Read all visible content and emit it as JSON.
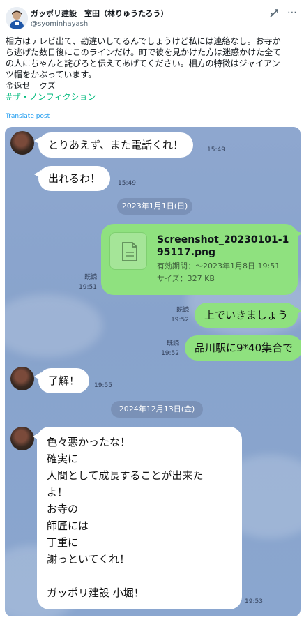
{
  "post": {
    "display_name": "ガッポリ建設　室田（林りゅうたろう）",
    "handle": "@syominhayashi",
    "body_lines": [
      "相方はテレビ出て、勘違いしてるんでしょうけど私には連絡なし。お寺か",
      "ら逃げた数日後にこのラインだけ。町で彼を見かけた方は迷惑かけた全て",
      "の人にちゃんと詫びろと伝えてあげてください。相方の特徴はジャイアン",
      "ツ帽をかぶっています。",
      "金返せ　クズ"
    ],
    "hashtag": "#ザ・ノンフィクション",
    "translate": "Translate post"
  },
  "chat": {
    "messages": {
      "m1": {
        "text": "とりあえず、また電話くれ！",
        "time": "15:49"
      },
      "m2": {
        "text": "出れるわ！",
        "time": "15:49"
      },
      "date1": "2023年1月1日(日)",
      "file": {
        "name": "Screenshot_20230101-195117.png",
        "expire": "有効期間：～2023年1月8日 19:51",
        "size": "サイズ：327 KB",
        "read": "既読",
        "time": "19:51"
      },
      "m3": {
        "text": "上でいきましょう",
        "read": "既読",
        "time": "19:52"
      },
      "m4": {
        "text": "品川駅に9*40集合で",
        "read": "既読",
        "time": "19:52"
      },
      "m5": {
        "text": "了解！",
        "time": "19:55"
      },
      "date2": "2024年12月13日(金)",
      "m6": {
        "lines": [
          "色々悪かったな！",
          "確実に",
          "人間として成長することが出来た",
          "よ！",
          "お寺の",
          "師匠には",
          "丁重に",
          "謝っといてくれ！",
          "",
          "ガッポリ建設 小堀！"
        ],
        "time": "19:53"
      }
    }
  },
  "colors": {
    "line_bg": "#8ea7cf",
    "outgoing": "#8fe17f",
    "incoming": "#ffffff",
    "link": "#1d9bf0"
  }
}
